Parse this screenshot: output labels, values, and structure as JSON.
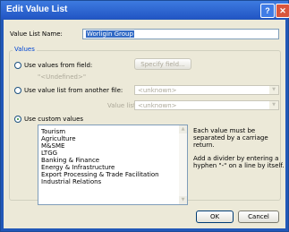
{
  "window": {
    "title": "Edit Value List",
    "help_glyph": "?",
    "close_glyph": "✕"
  },
  "name_field": {
    "label": "Value List Name:",
    "value": "Worligin Group"
  },
  "values_group": {
    "legend": "Values"
  },
  "option_field": {
    "label": "Use values from field:",
    "button": "Specify field...",
    "undefined_text": "\"<Undefined>\""
  },
  "option_other_file": {
    "label": "Use value list from another file:",
    "file_combo": "<unknown>",
    "value_list_label": "Value list:",
    "value_list_combo": "<unknown>"
  },
  "option_custom": {
    "label": "Use custom values",
    "selected": true,
    "items": [
      "Tourism",
      "Agriculture",
      "M&SME",
      "LTGG",
      "Banking & Finance",
      "Energy & Infrastructure",
      "Export Processing & Trade Facilitation",
      "Industrial Relations"
    ],
    "note1": [
      "Each value must be",
      "separated by a carriage",
      "return."
    ],
    "note2": [
      "Add a divider by entering a",
      "hyphen \"-\" on a line by itself."
    ]
  },
  "buttons": {
    "ok": "OK",
    "cancel": "Cancel"
  },
  "colors": {
    "title_bar": "#2255c4",
    "face": "#ece9d8",
    "legend": "#0046d5",
    "selection": "#316ac5"
  }
}
